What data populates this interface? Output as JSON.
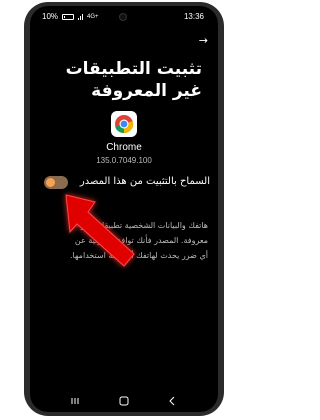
{
  "status_bar": {
    "left_text": "10%",
    "network": "4G+",
    "time": "13:36"
  },
  "header": {
    "back_icon": "arrow-right-icon",
    "title": "تثبيت التطبيقات غير المعروفة"
  },
  "app": {
    "icon": "chrome-icon",
    "name": "Chrome",
    "version": "135.0.7049.100"
  },
  "setting": {
    "label": "السماح بالتثبيت من هذا المصدر",
    "enabled": false,
    "accent_color": "#f7a253"
  },
  "warning_text": "هاتفك والبيانات الشخصية تطبيقات غير معروفة. المصدر فأنك توافق سؤولية عن أي ضرر يحدث لهاتفك أو نتيجة استخدامها.",
  "overlay": {
    "arrow_color": "#e00000"
  }
}
